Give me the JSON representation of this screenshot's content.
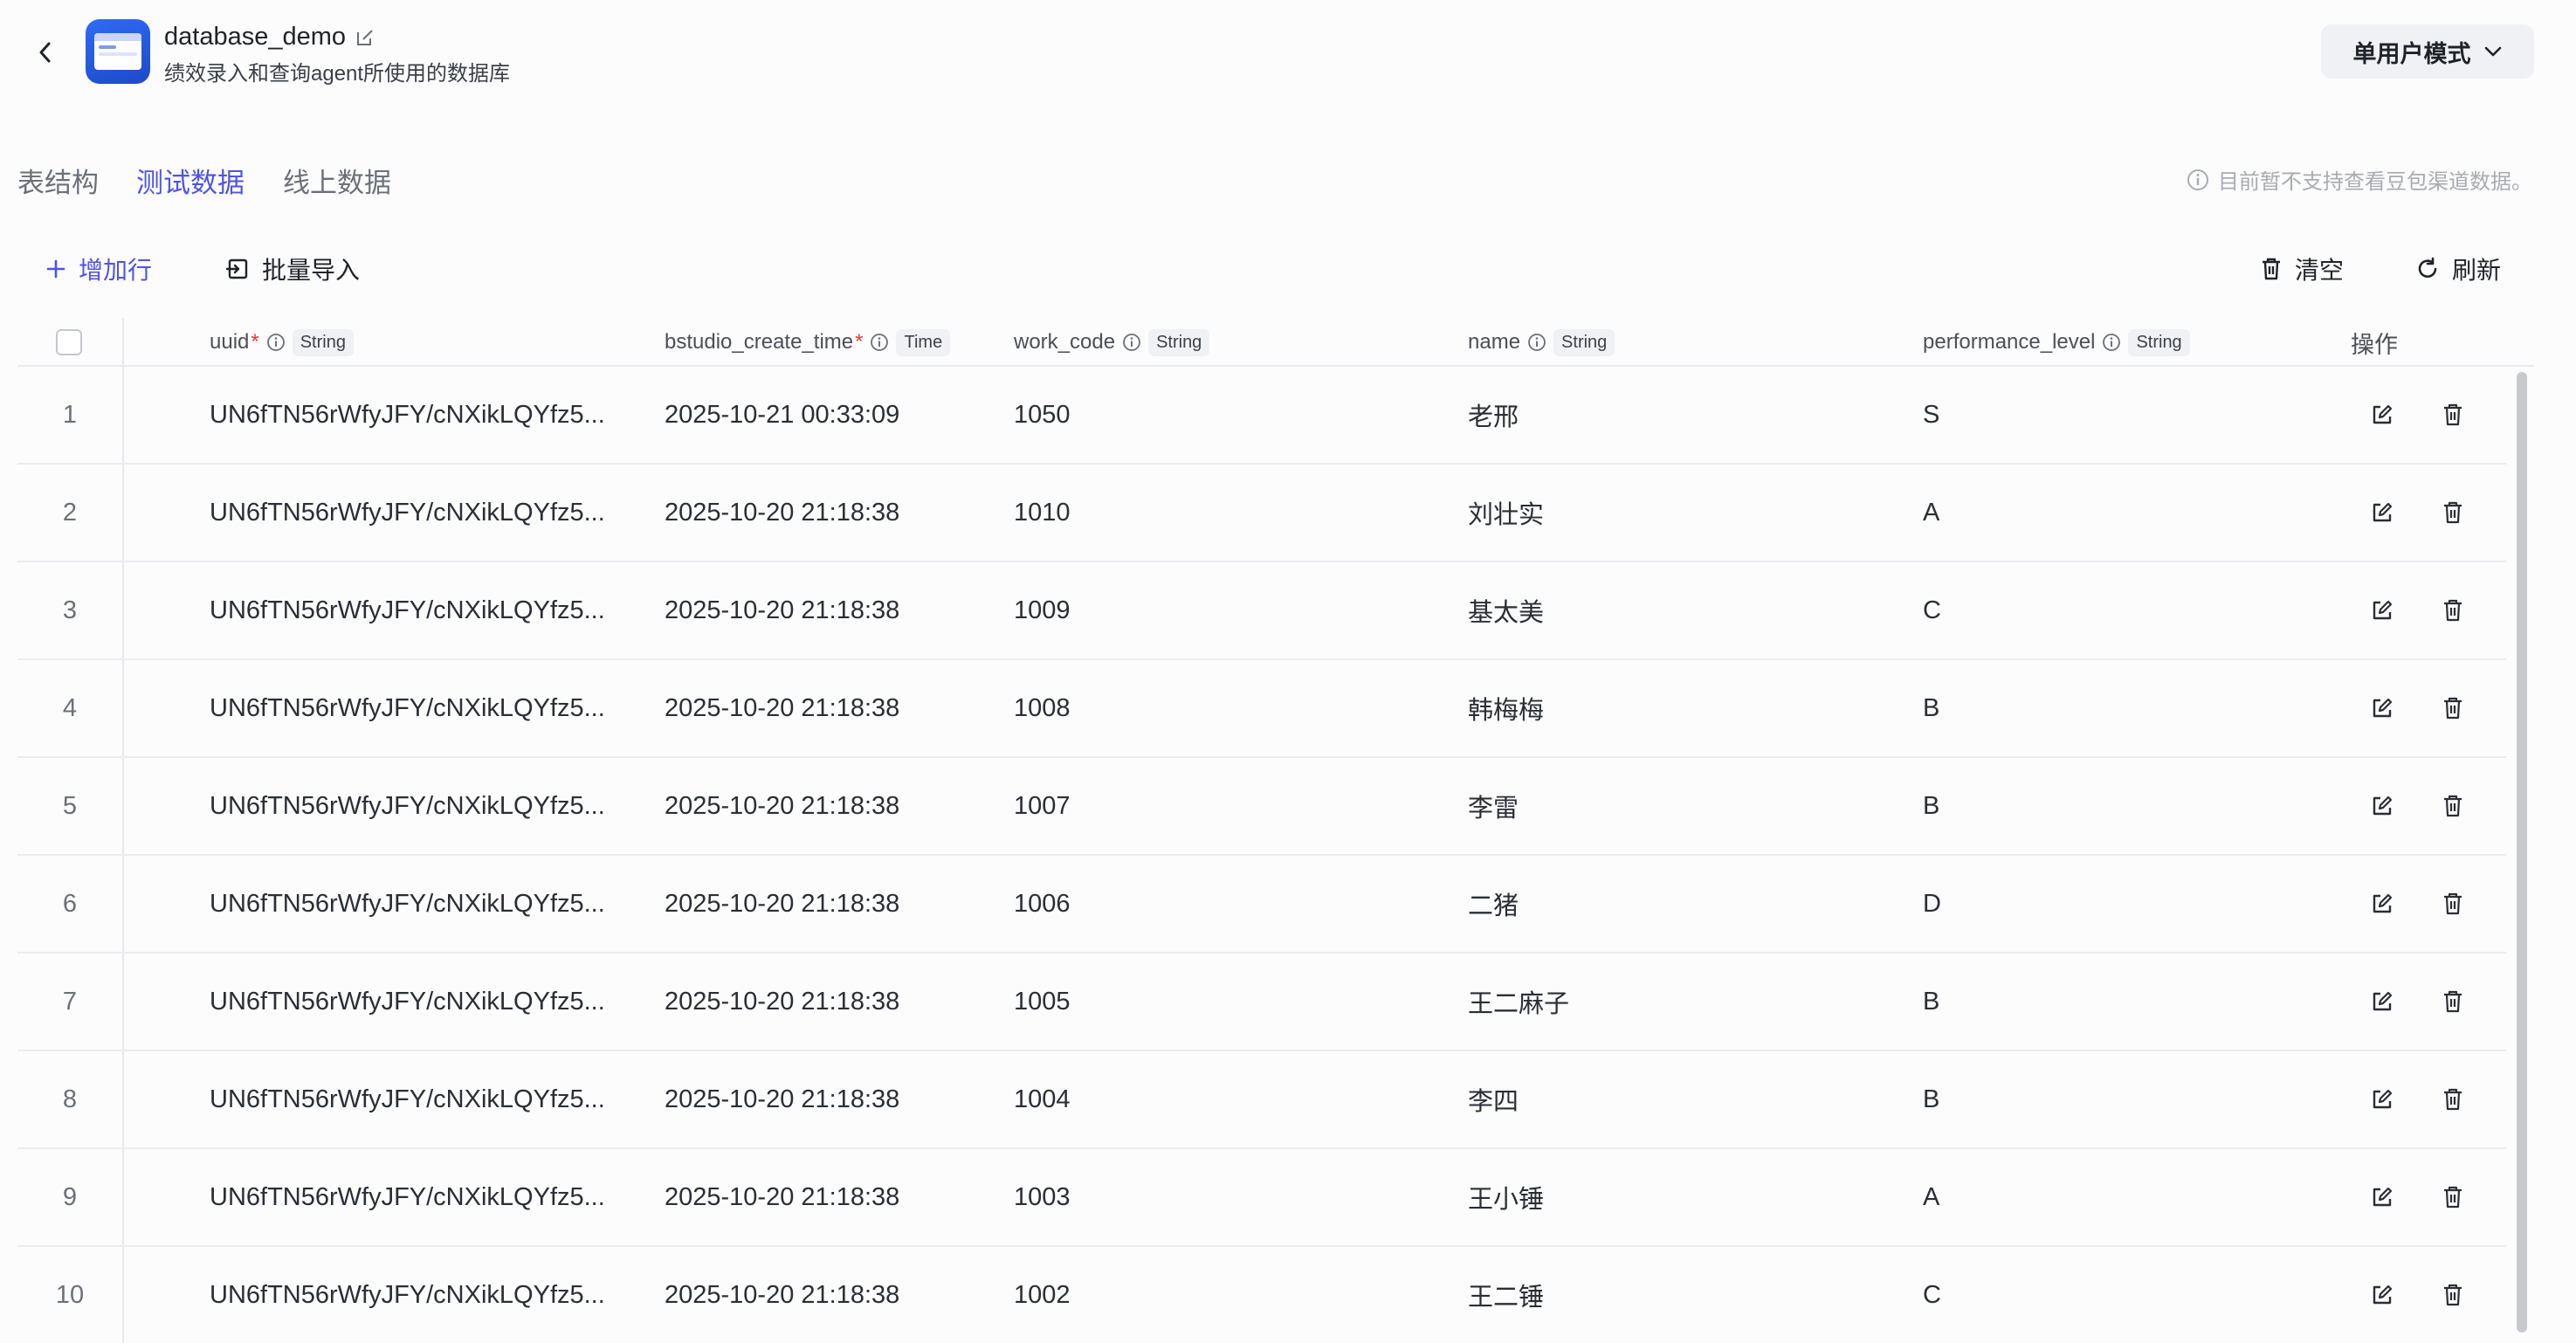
{
  "header": {
    "db_name": "database_demo",
    "db_desc": "绩效录入和查询agent所使用的数据库",
    "mode_label": "单用户模式"
  },
  "tabs": [
    {
      "label": "表结构",
      "active": false
    },
    {
      "label": "测试数据",
      "active": true
    },
    {
      "label": "线上数据",
      "active": false
    }
  ],
  "notice": "目前暂不支持查看豆包渠道数据。",
  "toolbar": {
    "add_row": "增加行",
    "batch_import": "批量导入",
    "clear": "清空",
    "refresh": "刷新"
  },
  "columns": [
    {
      "name": "uuid",
      "required": "*",
      "type": "String"
    },
    {
      "name": "bstudio_create_time",
      "required": "*",
      "type": "Time"
    },
    {
      "name": "work_code",
      "required": "",
      "type": "String"
    },
    {
      "name": "name",
      "required": "",
      "type": "String"
    },
    {
      "name": "performance_level",
      "required": "",
      "type": "String"
    },
    {
      "name": "操作"
    }
  ],
  "rows": [
    {
      "idx": "1",
      "uuid": "UN6fTN56rWfyJFY/cNXikLQYfz5...",
      "time": "2025-10-21 00:33:09",
      "code": "1050",
      "name": "老邢",
      "level": "S"
    },
    {
      "idx": "2",
      "uuid": "UN6fTN56rWfyJFY/cNXikLQYfz5...",
      "time": "2025-10-20 21:18:38",
      "code": "1010",
      "name": "刘壮实",
      "level": "A"
    },
    {
      "idx": "3",
      "uuid": "UN6fTN56rWfyJFY/cNXikLQYfz5...",
      "time": "2025-10-20 21:18:38",
      "code": "1009",
      "name": "基太美",
      "level": "C"
    },
    {
      "idx": "4",
      "uuid": "UN6fTN56rWfyJFY/cNXikLQYfz5...",
      "time": "2025-10-20 21:18:38",
      "code": "1008",
      "name": "韩梅梅",
      "level": "B"
    },
    {
      "idx": "5",
      "uuid": "UN6fTN56rWfyJFY/cNXikLQYfz5...",
      "time": "2025-10-20 21:18:38",
      "code": "1007",
      "name": "李雷",
      "level": "B"
    },
    {
      "idx": "6",
      "uuid": "UN6fTN56rWfyJFY/cNXikLQYfz5...",
      "time": "2025-10-20 21:18:38",
      "code": "1006",
      "name": "二猪",
      "level": "D"
    },
    {
      "idx": "7",
      "uuid": "UN6fTN56rWfyJFY/cNXikLQYfz5...",
      "time": "2025-10-20 21:18:38",
      "code": "1005",
      "name": "王二麻子",
      "level": "B"
    },
    {
      "idx": "8",
      "uuid": "UN6fTN56rWfyJFY/cNXikLQYfz5...",
      "time": "2025-10-20 21:18:38",
      "code": "1004",
      "name": "李四",
      "level": "B"
    },
    {
      "idx": "9",
      "uuid": "UN6fTN56rWfyJFY/cNXikLQYfz5...",
      "time": "2025-10-20 21:18:38",
      "code": "1003",
      "name": "王小锤",
      "level": "A"
    },
    {
      "idx": "10",
      "uuid": "UN6fTN56rWfyJFY/cNXikLQYfz5...",
      "time": "2025-10-20 21:18:38",
      "code": "1002",
      "name": "王二锤",
      "level": "C"
    }
  ],
  "colors": {
    "accent": "#4d53e8",
    "required": "#e03a3a"
  }
}
